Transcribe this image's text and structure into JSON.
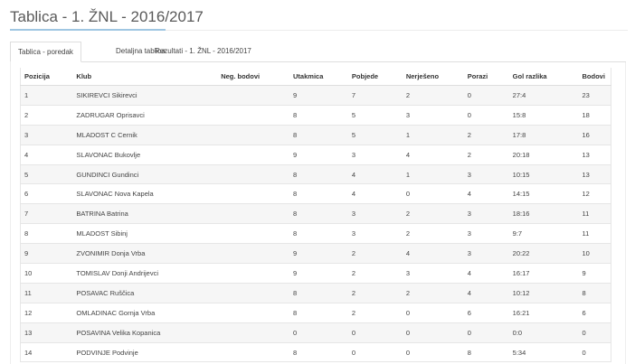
{
  "page_title": "Tablica - 1. ŽNL - 2016/2017",
  "tabs": [
    {
      "label": "Tablica - poredak",
      "active": true
    },
    {
      "label": "Detaljna tablica",
      "active": false
    },
    {
      "label": "Rezultati - 1. ŽNL - 2016/2017",
      "active": false
    }
  ],
  "table": {
    "headers": [
      "Pozicija",
      "Klub",
      "Neg. bodovi",
      "Utakmica",
      "Pobjede",
      "Nerješeno",
      "Porazi",
      "Gol razlika",
      "Bodovi"
    ],
    "rows": [
      [
        "1",
        "SIKIREVCI Sikirevci",
        "",
        "9",
        "7",
        "2",
        "0",
        "27:4",
        "23"
      ],
      [
        "2",
        "ZADRUGAR Oprisavci",
        "",
        "8",
        "5",
        "3",
        "0",
        "15:8",
        "18"
      ],
      [
        "3",
        "MLADOST C Cernik",
        "",
        "8",
        "5",
        "1",
        "2",
        "17:8",
        "16"
      ],
      [
        "4",
        "SLAVONAC Bukovlje",
        "",
        "9",
        "3",
        "4",
        "2",
        "20:18",
        "13"
      ],
      [
        "5",
        "GUNDINCI Gundinci",
        "",
        "8",
        "4",
        "1",
        "3",
        "10:15",
        "13"
      ],
      [
        "6",
        "SLAVONAC Nova Kapela",
        "",
        "8",
        "4",
        "0",
        "4",
        "14:15",
        "12"
      ],
      [
        "7",
        "BATRINA Batrina",
        "",
        "8",
        "3",
        "2",
        "3",
        "18:16",
        "11"
      ],
      [
        "8",
        "MLADOST Sibinj",
        "",
        "8",
        "3",
        "2",
        "3",
        "9:7",
        "11"
      ],
      [
        "9",
        "ZVONIMIR Donja Vrba",
        "",
        "9",
        "2",
        "4",
        "3",
        "20:22",
        "10"
      ],
      [
        "10",
        "TOMISLAV Donji Andrijevci",
        "",
        "9",
        "2",
        "3",
        "4",
        "16:17",
        "9"
      ],
      [
        "11",
        "POSAVAC Ruščica",
        "",
        "8",
        "2",
        "2",
        "4",
        "10:12",
        "8"
      ],
      [
        "12",
        "OMLADINAC Gornja Vrba",
        "",
        "8",
        "2",
        "0",
        "6",
        "16:21",
        "6"
      ],
      [
        "13",
        "POSAVINA Velika Kopanica",
        "",
        "0",
        "0",
        "0",
        "0",
        "0:0",
        "0"
      ],
      [
        "14",
        "PODVINJE Podvinje",
        "",
        "8",
        "0",
        "0",
        "8",
        "5:34",
        "0"
      ]
    ]
  },
  "colors": {
    "accent_underline": "#9fc6e2",
    "row_stripe": "#f6f6f6",
    "border": "#dddddd"
  }
}
